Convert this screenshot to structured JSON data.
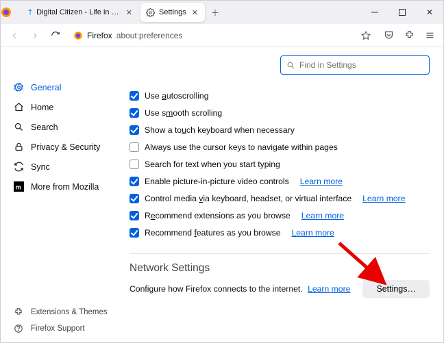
{
  "titlebar": {
    "tab1": {
      "label": "Digital Citizen - Life in a digital"
    },
    "tab2": {
      "label": "Settings"
    }
  },
  "toolbar": {
    "identity": "Firefox",
    "url": "about:preferences"
  },
  "search": {
    "placeholder": "Find in Settings"
  },
  "sidebar": {
    "items": [
      {
        "label": "General"
      },
      {
        "label": "Home"
      },
      {
        "label": "Search"
      },
      {
        "label": "Privacy & Security"
      },
      {
        "label": "Sync"
      },
      {
        "label": "More from Mozilla"
      }
    ],
    "footer": [
      {
        "label": "Extensions & Themes"
      },
      {
        "label": "Firefox Support"
      }
    ]
  },
  "options": [
    {
      "checked": true,
      "label": "Use autoscrolling",
      "accel": "a"
    },
    {
      "checked": true,
      "label": "Use smooth scrolling",
      "accel": "m"
    },
    {
      "checked": true,
      "label": "Show a touch keyboard when necessary",
      "accel": "u"
    },
    {
      "checked": false,
      "label": "Always use the cursor keys to navigate within pages"
    },
    {
      "checked": false,
      "label": "Search for text when you start typing"
    },
    {
      "checked": true,
      "label": "Enable picture-in-picture video controls",
      "learn": "Learn more"
    },
    {
      "checked": true,
      "label": "Control media via keyboard, headset, or virtual interface",
      "accel": "v",
      "learn": "Learn more"
    },
    {
      "checked": true,
      "label": "Recommend extensions as you browse",
      "accel": "e",
      "learn": "Learn more"
    },
    {
      "checked": true,
      "label": "Recommend features as you browse",
      "accel": "f",
      "learn": "Learn more"
    }
  ],
  "network": {
    "heading": "Network Settings",
    "desc": "Configure how Firefox connects to the internet.",
    "learn": "Learn more",
    "button": "Settings…"
  },
  "learn_more_text": "Learn more"
}
